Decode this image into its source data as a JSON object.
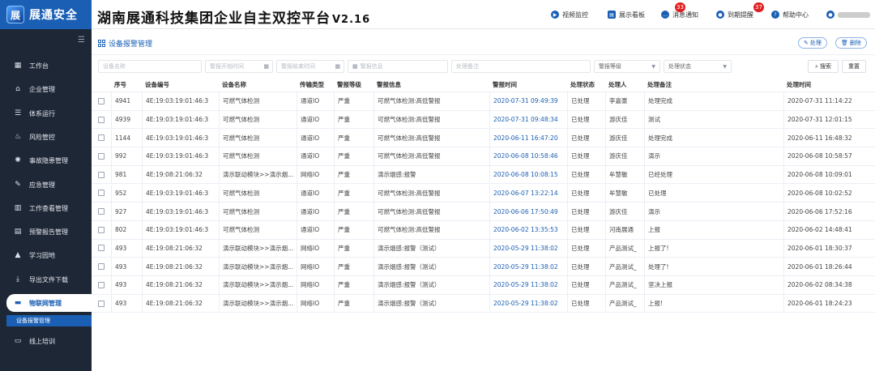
{
  "logo": {
    "mark": "展",
    "text": "展通安全"
  },
  "app": {
    "title": "湖南展通科技集团企业自主双控平台",
    "version": "V2.16"
  },
  "topnav": {
    "video": "视频监控",
    "board": "展示看板",
    "notice": "消息通知",
    "notice_count": "33",
    "reminder": "到期提醒",
    "reminder_count": "37",
    "help": "帮助中心"
  },
  "sidebar": {
    "items": [
      {
        "label": "工作台",
        "icon": "desk-icon"
      },
      {
        "label": "企业管理",
        "icon": "home-icon"
      },
      {
        "label": "体系运行",
        "icon": "stack-icon"
      },
      {
        "label": "风险管控",
        "icon": "flame-icon"
      },
      {
        "label": "事故隐患管理",
        "icon": "hazard-icon"
      },
      {
        "label": "应急管理",
        "icon": "edit-icon"
      },
      {
        "label": "工作查看管理",
        "icon": "calendar-icon"
      },
      {
        "label": "预警报告管理",
        "icon": "report-icon"
      },
      {
        "label": "学习园地",
        "icon": "graduation-icon"
      },
      {
        "label": "导出文件下载",
        "icon": "download-icon"
      },
      {
        "label": "物联网管理",
        "icon": "iot-icon"
      },
      {
        "label": "线上培训",
        "icon": "screen-icon"
      }
    ],
    "sub_item": "设备报警管理"
  },
  "panel": {
    "title": "设备报警管理",
    "process_btn": "处理",
    "delete_btn": "删除"
  },
  "filters": {
    "device_name": "设备名称",
    "alarm_start": "警报开始时间",
    "alarm_end": "警报结束时间",
    "alarm_info": "警报信息",
    "process_note": "处理备注",
    "alarm_level": "警报等级",
    "process_status": "处理状态",
    "search_btn": "搜索",
    "reset_btn": "重置"
  },
  "table": {
    "columns": [
      "序号",
      "设备编号",
      "设备名称",
      "传输类型",
      "警报等级",
      "警报信息",
      "警报时间",
      "处理状态",
      "处理人",
      "处理备注",
      "处理时间"
    ],
    "rows": [
      [
        "4941",
        "4E:19:03:19:01:46:3",
        "可燃气体检测",
        "通道IO",
        "严重",
        "可燃气体检测:高低警报",
        "2020-07-31 09:49:39",
        "已处理",
        "李嘉豪",
        "处理完成",
        "2020-07-31 11:14:22"
      ],
      [
        "4939",
        "4E:19:03:19:01:46:3",
        "可燃气体检测",
        "通道IO",
        "严重",
        "可燃气体检测:高低警报",
        "2020-07-31 09:48:34",
        "已处理",
        "游庆佳",
        "测试",
        "2020-07-31 12:01:15"
      ],
      [
        "1144",
        "4E:19:03:19:01:46:3",
        "可燃气体检测",
        "通道IO",
        "严重",
        "可燃气体检测:高低警报",
        "2020-06-11 16:47:20",
        "已处理",
        "游庆佳",
        "处理完成",
        "2020-06-11 16:48:32"
      ],
      [
        "992",
        "4E:19:03:19:01:46:3",
        "可燃气体检测",
        "通道IO",
        "严重",
        "可燃气体检测:高低警报",
        "2020-06-08 10:58:46",
        "已处理",
        "游庆佳",
        "演示",
        "2020-06-08 10:58:57"
      ],
      [
        "981",
        "4E:19:08:21:06:32",
        "演示联动模块>>演示烟...",
        "网络IO",
        "严重",
        "演示烟感:报警",
        "2020-06-08 10:08:15",
        "已处理",
        "牟慧敏",
        "已经处理",
        "2020-06-08 10:09:01"
      ],
      [
        "952",
        "4E:19:03:19:01:46:3",
        "可燃气体检测",
        "通道IO",
        "严重",
        "可燃气体检测:高低警报",
        "2020-06-07 13:22:14",
        "已处理",
        "牟慧敏",
        "已处理",
        "2020-06-08 10:02:52"
      ],
      [
        "927",
        "4E:19:03:19:01:46:3",
        "可燃气体检测",
        "通道IO",
        "严重",
        "可燃气体检测:高低警报",
        "2020-06-06 17:50:49",
        "已处理",
        "游庆佳",
        "演示",
        "2020-06-06 17:52:16"
      ],
      [
        "802",
        "4E:19:03:19:01:46:3",
        "可燃气体检测",
        "通道IO",
        "严重",
        "可燃气体检测:高低警报",
        "2020-06-02 13:35:53",
        "已处理",
        "河南展通",
        "上报",
        "2020-06-02 14:48:41"
      ],
      [
        "493",
        "4E:19:08:21:06:32",
        "演示联动模块>>演示烟...",
        "网络IO",
        "严重",
        "演示烟感:报警（测试）",
        "2020-05-29 11:38:02",
        "已处理",
        "产品测试_",
        "上报了!",
        "2020-06-01 18:30:37"
      ],
      [
        "493",
        "4E:19:08:21:06:32",
        "演示联动模块>>演示烟...",
        "网络IO",
        "严重",
        "演示烟感:报警（测试）",
        "2020-05-29 11:38:02",
        "已处理",
        "产品测试_",
        "处理了!",
        "2020-06-01 18:26:44"
      ],
      [
        "493",
        "4E:19:08:21:06:32",
        "演示联动模块>>演示烟...",
        "网络IO",
        "严重",
        "演示烟感:报警（测试）",
        "2020-05-29 11:38:02",
        "已处理",
        "产品测试_",
        "坚决上报",
        "2020-06-02 08:34:38"
      ],
      [
        "493",
        "4E:19:08:21:06:32",
        "演示联动模块>>演示烟...",
        "网络IO",
        "严重",
        "演示烟感:报警（测试）",
        "2020-05-29 11:38:02",
        "已处理",
        "产品测试_",
        "上报!",
        "2020-06-01 18:24:23"
      ]
    ]
  }
}
